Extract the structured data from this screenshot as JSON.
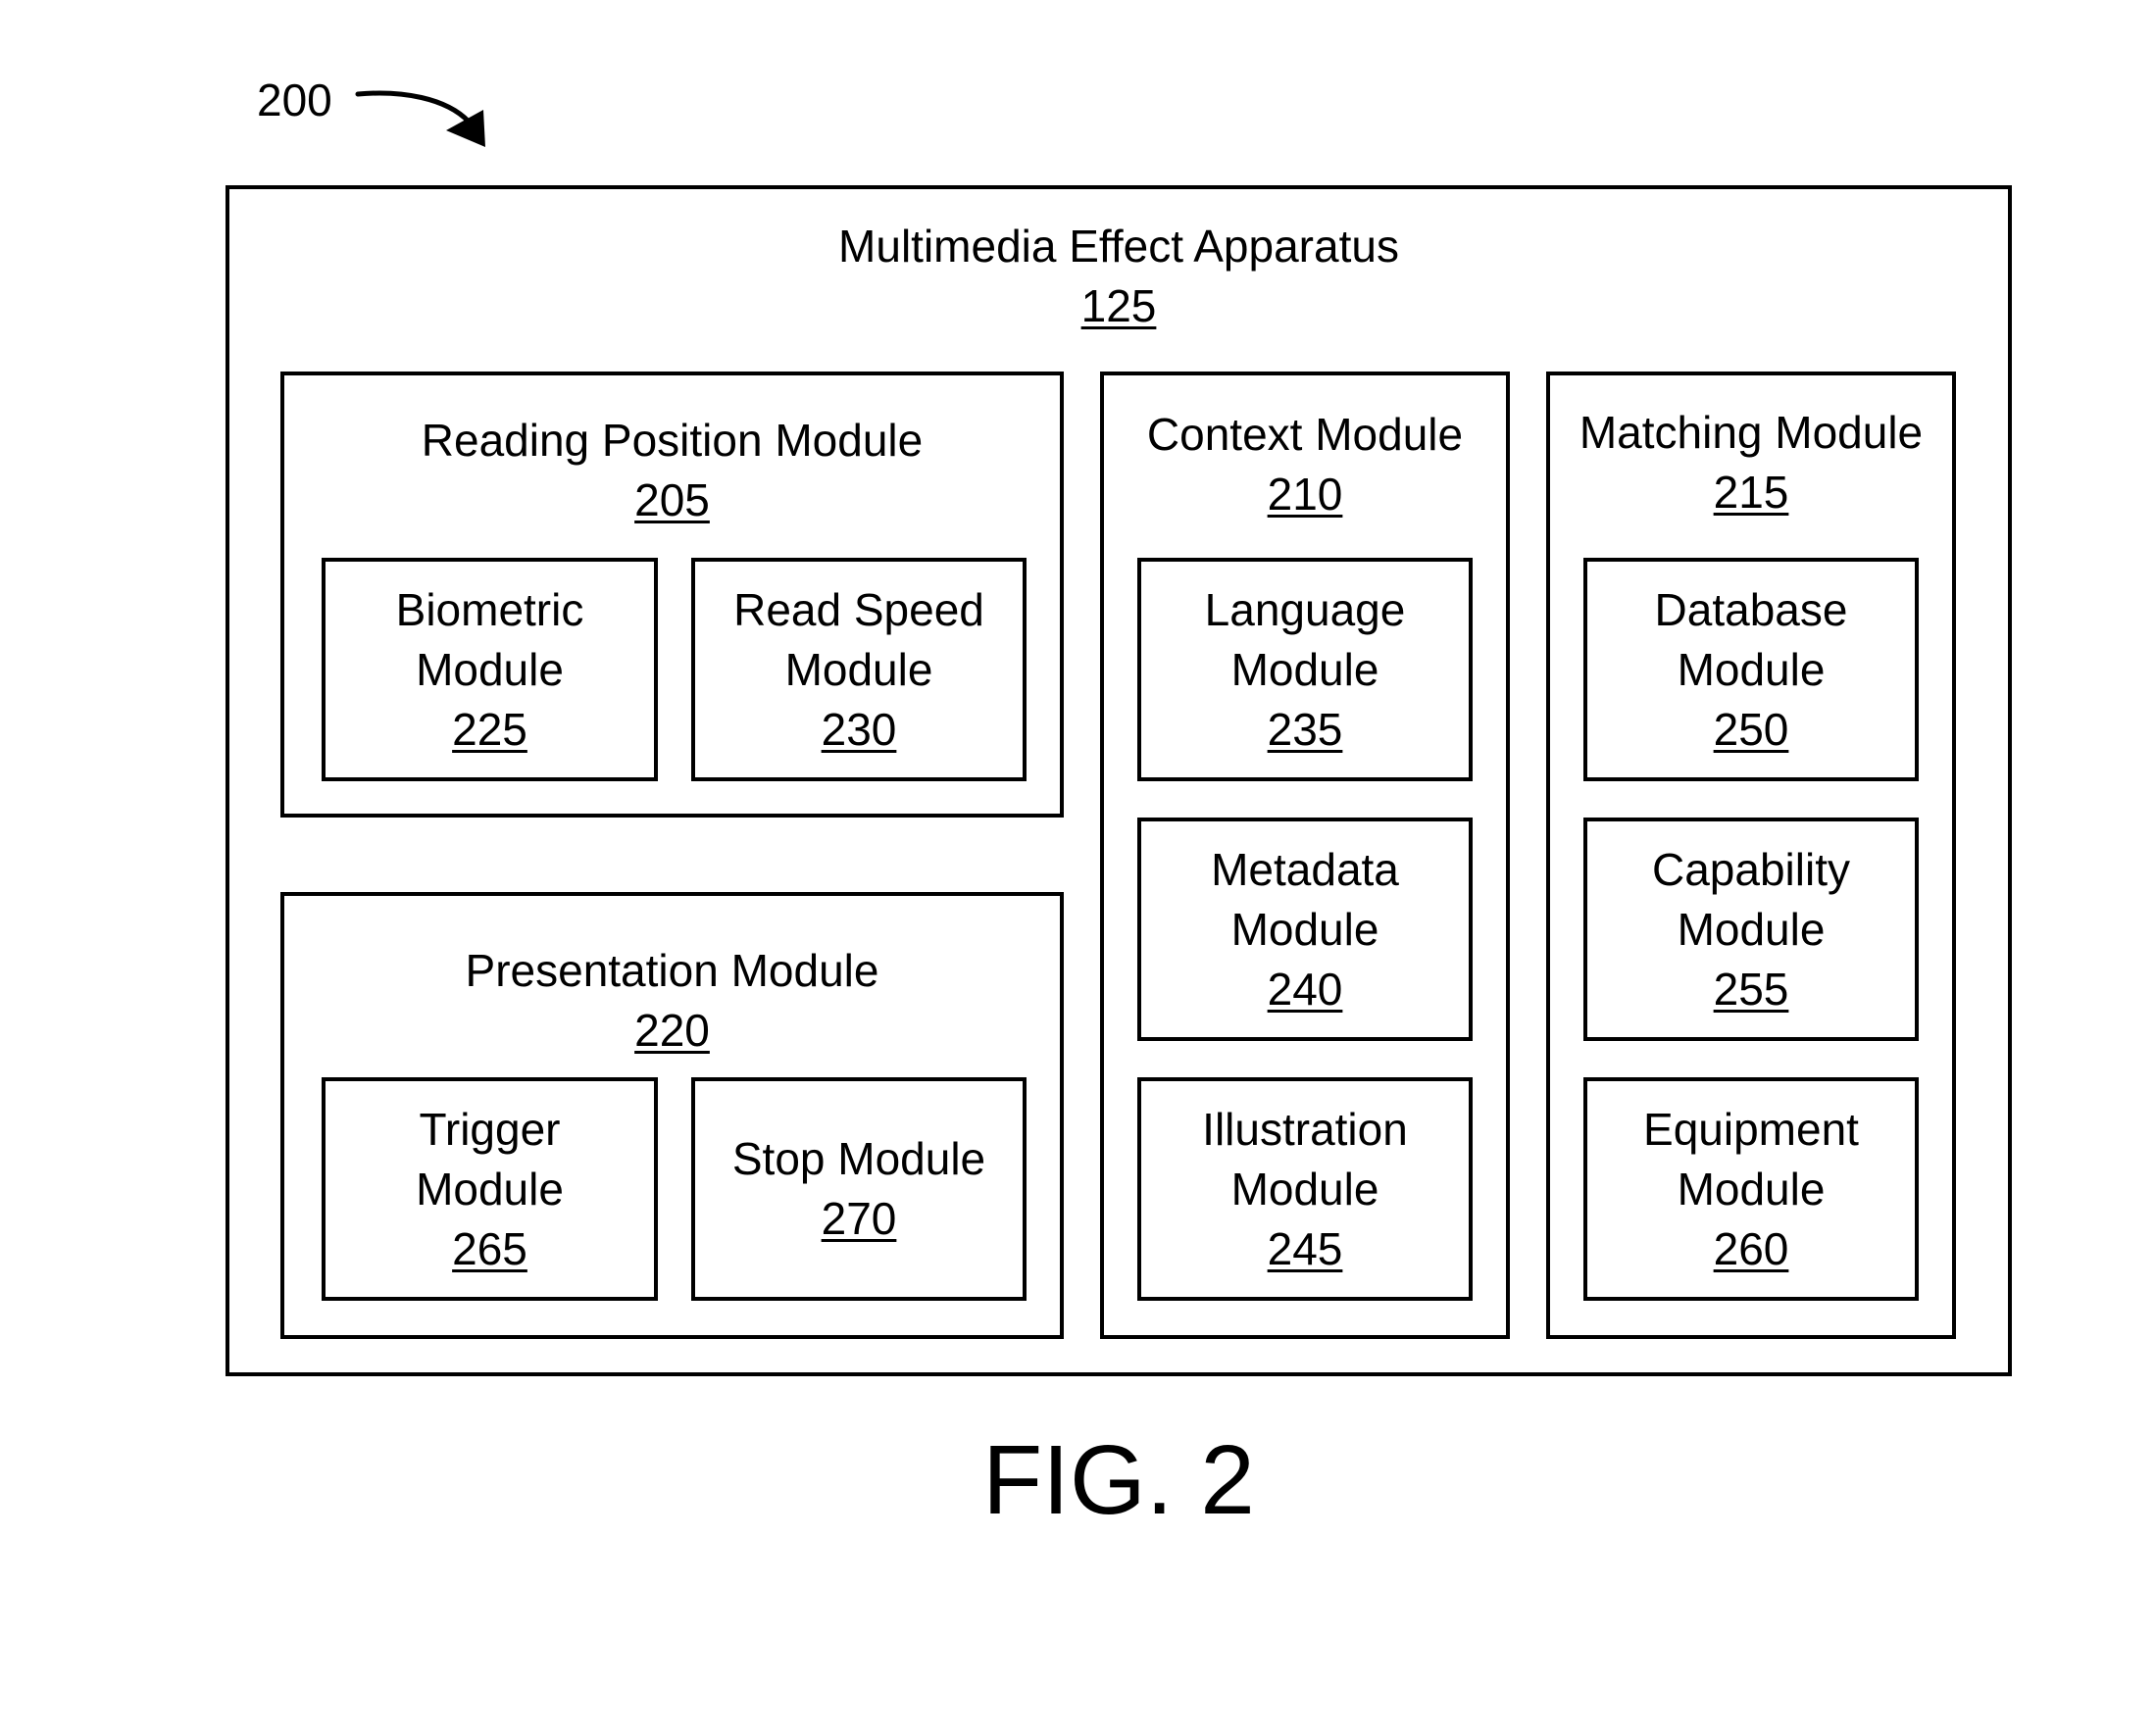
{
  "figure": {
    "reference_number": "200",
    "caption": "FIG. 2"
  },
  "apparatus": {
    "name": "Multimedia Effect Apparatus",
    "number": "125"
  },
  "groups": {
    "reading_position": {
      "name": "Reading Position Module",
      "number": "205",
      "children": [
        {
          "name": "Biometric Module",
          "number": "225"
        },
        {
          "name": "Read Speed Module",
          "number": "230"
        }
      ]
    },
    "presentation": {
      "name": "Presentation Module",
      "number": "220",
      "children": [
        {
          "name": "Trigger Module",
          "number": "265"
        },
        {
          "name": "Stop Module",
          "number": "270"
        }
      ]
    },
    "context": {
      "name": "Context Module",
      "number": "210",
      "children": [
        {
          "name": "Language Module",
          "number": "235"
        },
        {
          "name": "Metadata Module",
          "number": "240"
        },
        {
          "name": "Illustration Module",
          "number": "245"
        }
      ]
    },
    "matching": {
      "name": "Matching Module",
      "number": "215",
      "children": [
        {
          "name": "Database Module",
          "number": "250"
        },
        {
          "name": "Capability Module",
          "number": "255"
        },
        {
          "name": "Equipment Module",
          "number": "260"
        }
      ]
    }
  }
}
